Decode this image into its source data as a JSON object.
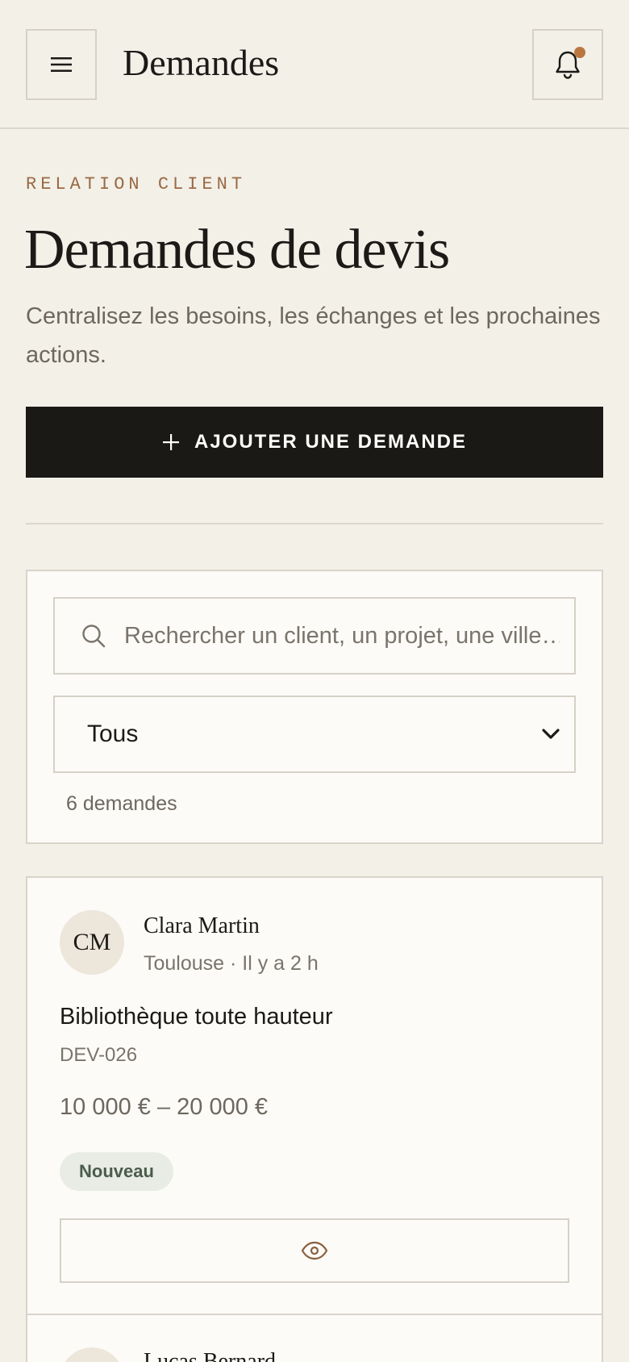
{
  "header": {
    "title": "Demandes",
    "menu_icon": "hamburger-icon",
    "bell_icon": "bell-icon",
    "notification_dot_color": "#b9773f"
  },
  "intro": {
    "eyebrow": "RELATION CLIENT",
    "title": "Demandes de devis",
    "description": "Centralisez les besoins, les échanges et les prochaines actions.",
    "add_button_label": "AJOUTER UNE DEMANDE"
  },
  "filters": {
    "search_placeholder": "Rechercher un client, un projet, une ville…",
    "status_selected": "Tous",
    "count_label": "6 demandes"
  },
  "requests": [
    {
      "initials": "CM",
      "name": "Clara Martin",
      "meta": "Toulouse · Il y a 2 h",
      "project": "Bibliothèque toute hauteur",
      "ref": "DEV-026",
      "budget": "10 000 € – 20 000 €",
      "status": "Nouveau",
      "view_icon": "eye-icon"
    },
    {
      "initials": "",
      "name": "Lucas Bernard"
    }
  ],
  "colors": {
    "background": "#f3f0e8",
    "accent": "#9a6a44",
    "primary_button": "#1b1915",
    "badge_bg": "#e8ece4",
    "badge_text": "#4a5c4c"
  }
}
